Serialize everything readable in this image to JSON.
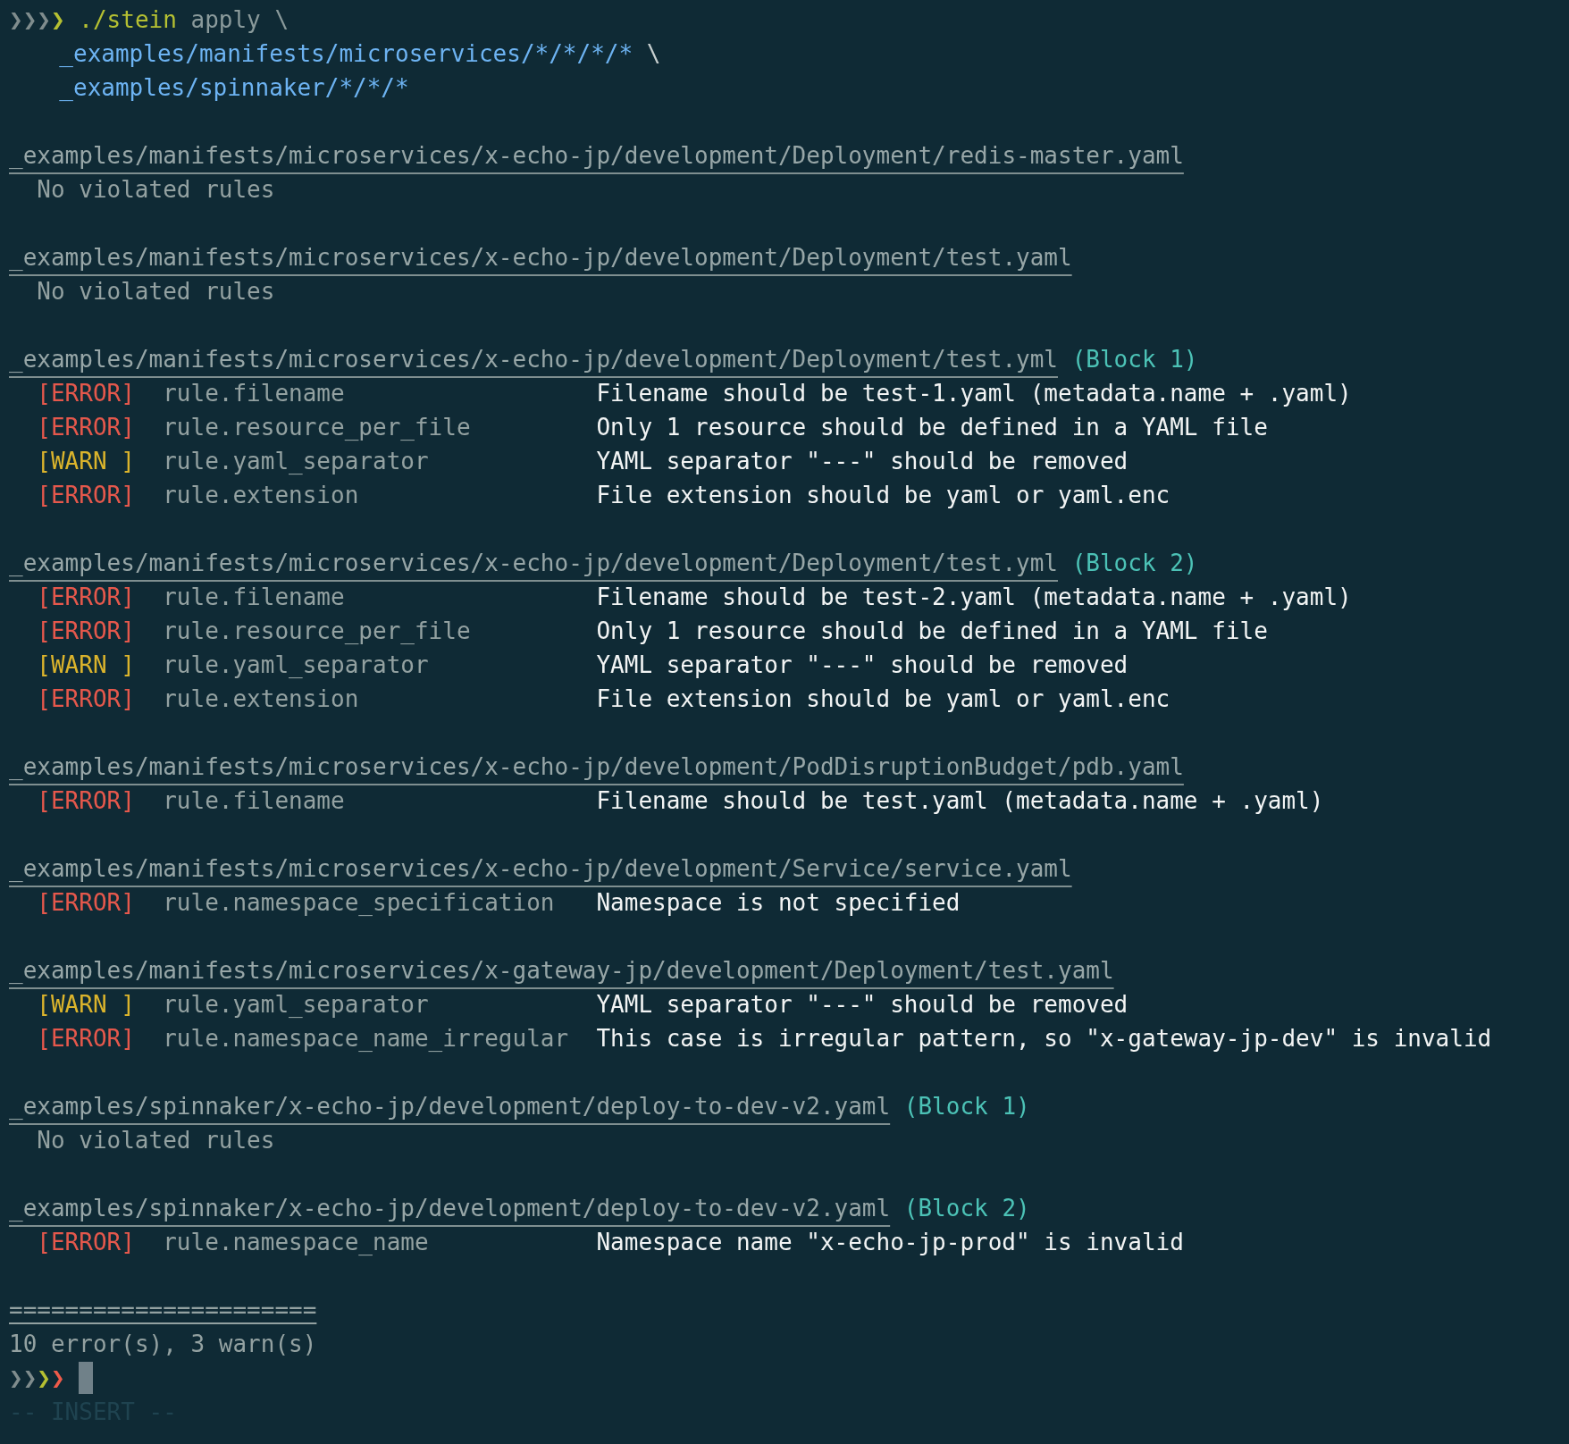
{
  "command": {
    "prompt": [
      {
        "char": "❯",
        "color": "#7f8c8d"
      },
      {
        "char": "❯",
        "color": "#7f8c8d"
      },
      {
        "char": "❯",
        "color": "#7f8c8d"
      },
      {
        "char": "❯",
        "color": "#b5c032"
      }
    ],
    "program": "./stein",
    "subcommand": "apply",
    "continuation": "\\",
    "args": [
      {
        "text": "_examples/manifests/microservices/*/*/*/*",
        "continuation": "\\"
      },
      {
        "text": "_examples/spinnaker/*/*/*"
      }
    ]
  },
  "results": [
    {
      "path": "_examples/manifests/microservices/x-echo-jp/development/Deployment/redis-master.yaml",
      "status": "No violated rules"
    },
    {
      "path": "_examples/manifests/microservices/x-echo-jp/development/Deployment/test.yaml",
      "status": "No violated rules"
    },
    {
      "path": "_examples/manifests/microservices/x-echo-jp/development/Deployment/test.yml",
      "block": "(Block 1)",
      "violations": [
        {
          "kind": "error",
          "tag": "[ERROR]",
          "rule": "rule.filename",
          "message": "Filename should be test-1.yaml (metadata.name + .yaml)"
        },
        {
          "kind": "error",
          "tag": "[ERROR]",
          "rule": "rule.resource_per_file",
          "message": "Only 1 resource should be defined in a YAML file"
        },
        {
          "kind": "warn",
          "tag": "[WARN ]",
          "rule": "rule.yaml_separator",
          "message": "YAML separator \"---\" should be removed"
        },
        {
          "kind": "error",
          "tag": "[ERROR]",
          "rule": "rule.extension",
          "message": "File extension should be yaml or yaml.enc"
        }
      ]
    },
    {
      "path": "_examples/manifests/microservices/x-echo-jp/development/Deployment/test.yml",
      "block": "(Block 2)",
      "violations": [
        {
          "kind": "error",
          "tag": "[ERROR]",
          "rule": "rule.filename",
          "message": "Filename should be test-2.yaml (metadata.name + .yaml)"
        },
        {
          "kind": "error",
          "tag": "[ERROR]",
          "rule": "rule.resource_per_file",
          "message": "Only 1 resource should be defined in a YAML file"
        },
        {
          "kind": "warn",
          "tag": "[WARN ]",
          "rule": "rule.yaml_separator",
          "message": "YAML separator \"---\" should be removed"
        },
        {
          "kind": "error",
          "tag": "[ERROR]",
          "rule": "rule.extension",
          "message": "File extension should be yaml or yaml.enc"
        }
      ]
    },
    {
      "path": "_examples/manifests/microservices/x-echo-jp/development/PodDisruptionBudget/pdb.yaml",
      "violations": [
        {
          "kind": "error",
          "tag": "[ERROR]",
          "rule": "rule.filename",
          "message": "Filename should be test.yaml (metadata.name + .yaml)"
        }
      ]
    },
    {
      "path": "_examples/manifests/microservices/x-echo-jp/development/Service/service.yaml",
      "violations": [
        {
          "kind": "error",
          "tag": "[ERROR]",
          "rule": "rule.namespace_specification",
          "message": "Namespace is not specified"
        }
      ]
    },
    {
      "path": "_examples/manifests/microservices/x-gateway-jp/development/Deployment/test.yaml",
      "violations": [
        {
          "kind": "warn",
          "tag": "[WARN ]",
          "rule": "rule.yaml_separator",
          "message": "YAML separator \"---\" should be removed"
        },
        {
          "kind": "error",
          "tag": "[ERROR]",
          "rule": "rule.namespace_name_irregular",
          "message": "This case is irregular pattern, so \"x-gateway-jp-dev\" is invalid"
        }
      ]
    },
    {
      "path": "_examples/spinnaker/x-echo-jp/development/deploy-to-dev-v2.yaml",
      "block": "(Block 1)",
      "status": "No violated rules"
    },
    {
      "path": "_examples/spinnaker/x-echo-jp/development/deploy-to-dev-v2.yaml",
      "block": "(Block 2)",
      "violations": [
        {
          "kind": "error",
          "tag": "[ERROR]",
          "rule": "rule.namespace_name",
          "message": "Namespace name \"x-echo-jp-prod\" is invalid"
        }
      ]
    }
  ],
  "separator": "======================",
  "summary": "10 error(s), 3 warn(s)",
  "prompt": [
    {
      "char": "❯",
      "color": "#7f8c8d"
    },
    {
      "char": "❯",
      "color": "#7f8c8d"
    },
    {
      "char": "❯",
      "color": "#b5c032"
    },
    {
      "char": "❯",
      "color": "#ef5b4a"
    }
  ],
  "mode": "-- INSERT --"
}
